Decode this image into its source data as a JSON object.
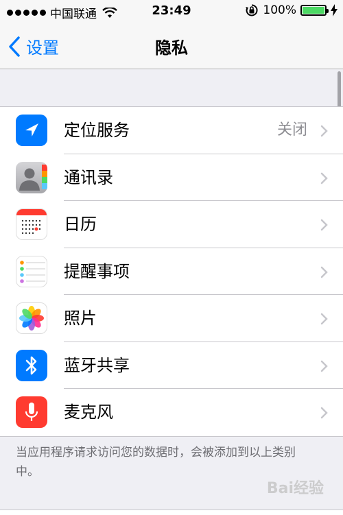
{
  "status_bar": {
    "carrier": "中国联通",
    "time": "23:49",
    "battery": "100%"
  },
  "nav": {
    "back_label": "设置",
    "title": "隐私"
  },
  "rows": [
    {
      "label": "定位服务",
      "value": "关闭",
      "icon": "location-arrow-icon",
      "icon_color": "#007aff"
    },
    {
      "label": "通讯录",
      "icon": "contacts-icon",
      "icon_color": "#8e8e93"
    },
    {
      "label": "日历",
      "icon": "calendar-icon",
      "icon_color": "#ff3b30"
    },
    {
      "label": "提醒事项",
      "icon": "reminders-icon",
      "icon_color": "#ffffff"
    },
    {
      "label": "照片",
      "icon": "photos-icon",
      "icon_color": "#ffffff"
    },
    {
      "label": "蓝牙共享",
      "icon": "bluetooth-icon",
      "icon_color": "#007aff"
    },
    {
      "label": "麦克风",
      "icon": "microphone-icon",
      "icon_color": "#ff3b30"
    }
  ],
  "footer_note": "当应用程序请求访问您的数据时，会被添加到以上类别中。",
  "watermark": "Bai经验"
}
